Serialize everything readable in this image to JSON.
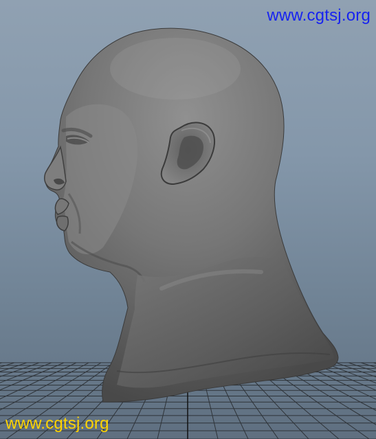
{
  "viewport": {
    "name": "3D viewport",
    "background_top": "#90a1b2",
    "background_bottom": "#5f6f80",
    "grid_color": "#2e3338",
    "model_color": "#6b6b6b"
  },
  "watermarks": {
    "top": "www.cgtsj.org",
    "bottom": "www.cgtsj.org",
    "top_color": "#1723f0",
    "bottom_color": "#ffd400"
  }
}
